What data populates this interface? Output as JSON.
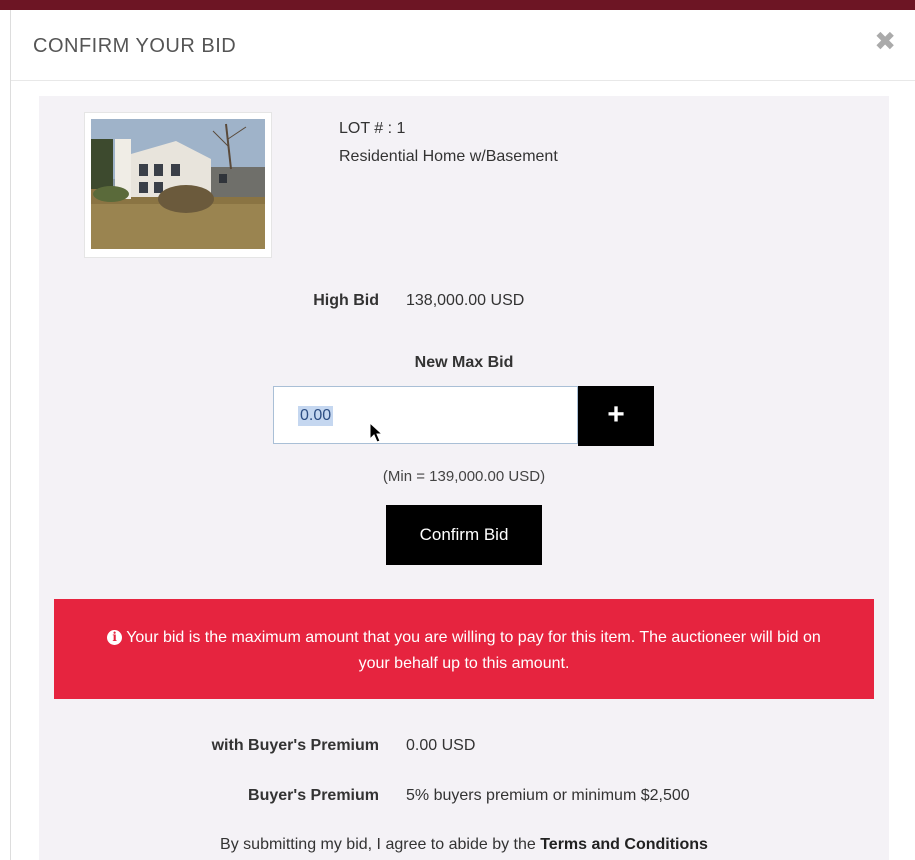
{
  "modal": {
    "title": "CONFIRM YOUR BID",
    "close_icon": "close-icon"
  },
  "lot": {
    "number": "LOT # : 1",
    "title": "Residential Home w/Basement",
    "image_alt": "house-photo"
  },
  "high_bid": {
    "label": "High Bid",
    "value": "138,000.00 USD"
  },
  "new_max_bid": {
    "label": "New Max Bid",
    "value": "0.00",
    "plus_label": "+",
    "min_text": "(Min = 139,000.00 USD)"
  },
  "confirm_button": "Confirm Bid",
  "alert": {
    "icon": "info-icon",
    "text": "Your bid is the maximum amount that you are willing to pay for this item. The auctioneer will bid on your behalf up to this amount.",
    "color": "#e6243f"
  },
  "premium": {
    "with_label": "with Buyer's Premium",
    "with_value": "0.00 USD",
    "label": "Buyer's Premium",
    "value": "5% buyers premium or minimum $2,500"
  },
  "terms": {
    "prefix": "By submitting my bid, I agree to abide by the ",
    "link": "Terms and Conditions"
  }
}
